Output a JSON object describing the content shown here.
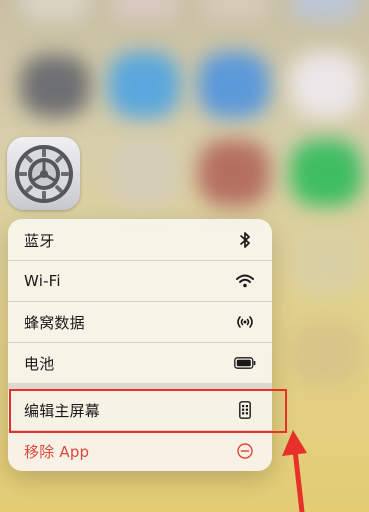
{
  "menu": {
    "items": [
      {
        "label": "蓝牙",
        "icon": "bluetooth-icon"
      },
      {
        "label": "Wi-Fi",
        "icon": "wifi-icon"
      },
      {
        "label": "蜂窝数据",
        "icon": "cellular-icon"
      },
      {
        "label": "电池",
        "icon": "battery-icon"
      },
      {
        "label": "编辑主屏幕",
        "icon": "phone-apps-icon"
      },
      {
        "label": "移除 App",
        "icon": "minus-circle-icon"
      }
    ]
  },
  "colors": {
    "destructive": "#e0463c",
    "highlight": "#e8302b"
  }
}
